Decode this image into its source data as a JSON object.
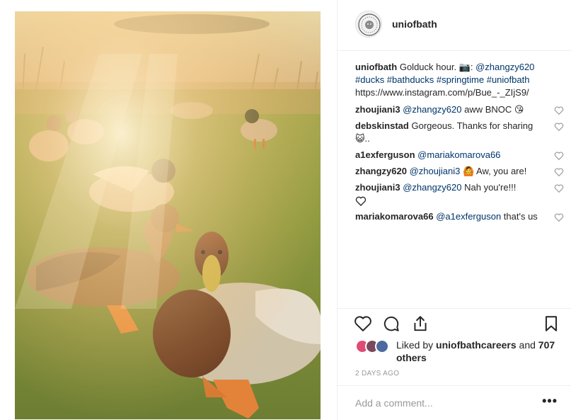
{
  "post": {
    "username": "uniofbath",
    "image_alt": "Ducks on grass by a pond in golden sunlight",
    "caption": {
      "user": "uniofbath",
      "text_before": "Golduck hour. ",
      "camera_glyph": "📷",
      "colon": ": ",
      "mention": "@zhangzy620",
      "hashtags": "#ducks #bathducks #springtime #uniofbath",
      "url": "https://www.instagram.com/p/Bue_-_ZIjS9/"
    },
    "comments": [
      {
        "user": "zhoujiani3",
        "mention": "@zhangzy620",
        "text": " aww BNOC 😘"
      },
      {
        "user": "debskinstad",
        "mention": "",
        "text": "Gorgeous. Thanks for sharing 😺.."
      },
      {
        "user": "a1exferguson",
        "mention": "@mariakomarova66",
        "text": ""
      },
      {
        "user": "zhangzy620",
        "mention": "@zhoujiani3",
        "text": " 🙆 Aw, you are!"
      },
      {
        "user": "zhoujiani3",
        "mention": "@zhangzy620",
        "text": " Nah you're!!!"
      },
      {
        "user": "mariakomarova66",
        "mention": "@a1exferguson",
        "text": " that's us"
      }
    ],
    "likes": {
      "prefix": "Liked by ",
      "user": "uniofbathcareers",
      "middle": " and ",
      "others": "707 others"
    },
    "timestamp": "2 DAYS AGO",
    "add_comment_placeholder": "Add a comment...",
    "more_label": "•••",
    "icons": [
      "heart-icon",
      "comment-icon",
      "share-icon",
      "bookmark-icon"
    ],
    "colors": {
      "link": "#003569",
      "text": "#262626",
      "muted": "#999999",
      "border": "#efefef"
    }
  }
}
